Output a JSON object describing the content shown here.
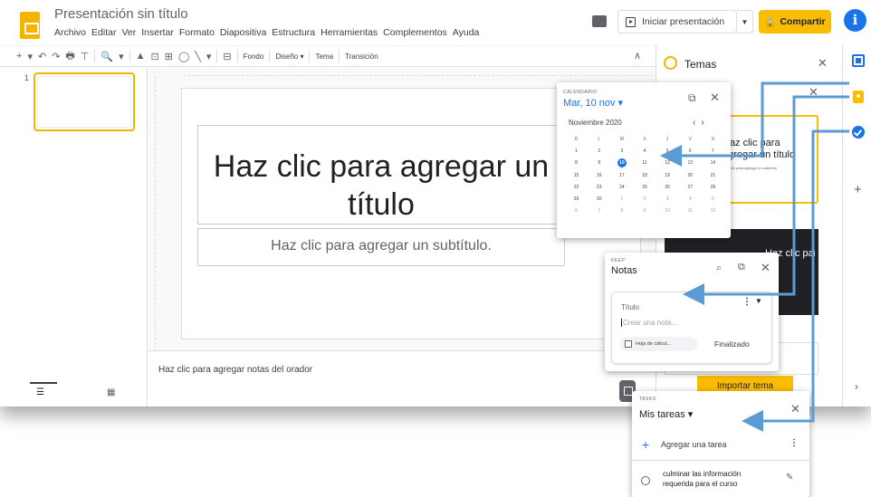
{
  "header": {
    "doc_title": "Presentación sin título",
    "menus": [
      "Archivo",
      "Editar",
      "Ver",
      "Insertar",
      "Formato",
      "Diapositiva",
      "Estructura",
      "Herramientas",
      "Complementos",
      "Ayuda"
    ],
    "present_label": "Iniciar presentación",
    "share_label": "Compartir",
    "share_icon": "🔒",
    "avatar_letter": "i"
  },
  "toolbar": {
    "icons": [
      "+",
      "▾",
      "↶",
      "↷",
      "🖶",
      "⊤",
      "🔍",
      "▾",
      "▲",
      "⊡",
      "⊞",
      "◯",
      "╲",
      "▾",
      "⊟"
    ],
    "background_label": "Fondo",
    "layout_label": "Diseño ▾",
    "theme_label": "Tema",
    "transition_label": "Transición"
  },
  "filmstrip": {
    "slide_number": "1"
  },
  "slide": {
    "title_placeholder": "Haz clic para agregar un título",
    "subtitle_placeholder": "Haz clic para agregar un subtítulo."
  },
  "notes": {
    "placeholder": "Haz clic para agregar notas del orador"
  },
  "themes_panel": {
    "title": "Temas",
    "card1_title": "Haz clic para agregar un título",
    "card1_subtitle": "Haz clic para agregar un subtítulo",
    "card2_title": "Haz clic para agregar un título",
    "import_label": "Importar tema"
  },
  "calendar": {
    "caption": "CALENDARIO",
    "date": "Mar, 10 nov ▾",
    "month": "Noviembre 2020",
    "weekdays": [
      "D",
      "L",
      "M",
      "X",
      "J",
      "V",
      "S"
    ],
    "days": [
      "1",
      "2",
      "3",
      "4",
      "5",
      "6",
      "7",
      "8",
      "9",
      "10",
      "11",
      "12",
      "13",
      "14",
      "15",
      "16",
      "17",
      "18",
      "19",
      "20",
      "21",
      "22",
      "23",
      "24",
      "25",
      "26",
      "27",
      "28",
      "29",
      "30",
      "1",
      "2",
      "3",
      "4",
      "5",
      "6",
      "7",
      "8",
      "9",
      "10",
      "11",
      "12"
    ],
    "today": "10"
  },
  "keep": {
    "caption": "KEEP",
    "title": "Notas",
    "note_title_placeholder": "Título",
    "note_body_placeholder": "Crear una nota...",
    "chip_label": "Hoja de cálcul...",
    "done_label": "Finalizado"
  },
  "tasks": {
    "caption": "TASKS",
    "list_name": "Mis tareas ▾",
    "add_label": "Agregar una tarea",
    "task_text": "culminar las información requerida para el curso"
  },
  "colors": {
    "accent_yellow": "#fbbc04",
    "blue": "#1a73e8",
    "arrow": "#5b9bd5"
  }
}
